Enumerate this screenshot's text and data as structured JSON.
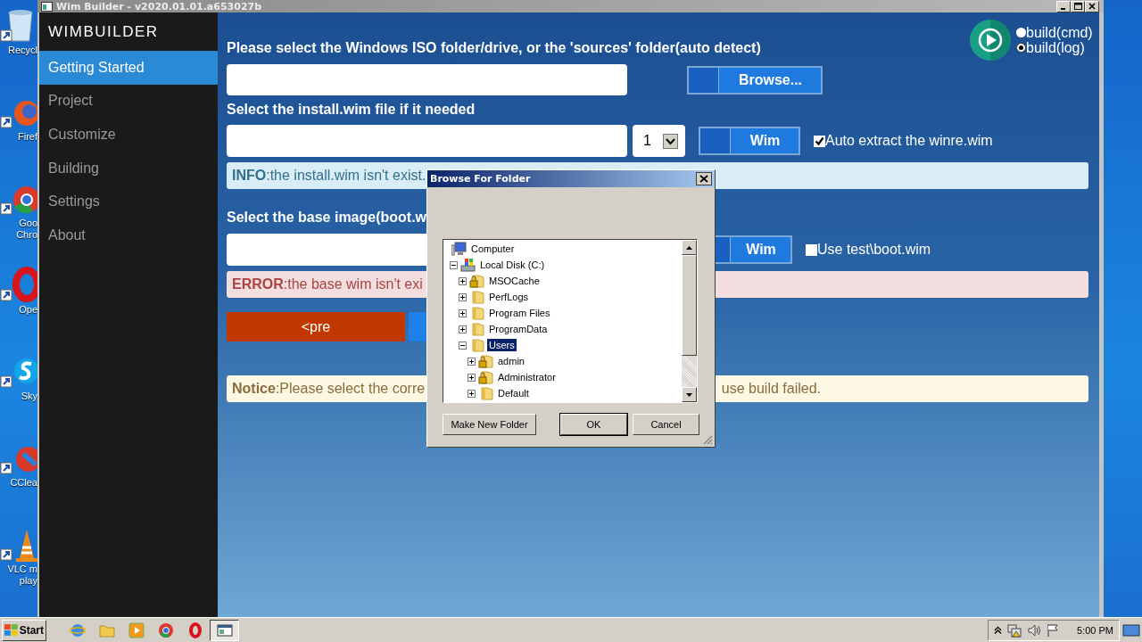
{
  "desktop_icons": [
    {
      "kind": "bin",
      "lines": [
        "Recycl"
      ]
    },
    {
      "kind": "fox",
      "lines": [
        "Firef"
      ]
    },
    {
      "kind": "chrome",
      "lines": [
        "Goo",
        "Chro"
      ]
    },
    {
      "kind": "opera",
      "lines": [
        "Ope"
      ]
    },
    {
      "kind": "skype",
      "lines": [
        "Sky"
      ]
    },
    {
      "kind": "brush",
      "lines": [
        "CClea"
      ]
    },
    {
      "kind": "cone",
      "lines": [
        "VLC m",
        "play"
      ]
    }
  ],
  "window": {
    "title": "Wim Builder - v2020.01.01.a653027b"
  },
  "sidebar": {
    "brand": "WIMBUILDER",
    "items": [
      {
        "label": "Getting Started",
        "selected": true
      },
      {
        "label": "Project",
        "selected": false
      },
      {
        "label": "Customize",
        "selected": false
      },
      {
        "label": "Building",
        "selected": false
      },
      {
        "label": "Settings",
        "selected": false
      },
      {
        "label": "About",
        "selected": false
      }
    ]
  },
  "build_modes": [
    {
      "label": "build(cmd)",
      "selected": false
    },
    {
      "label": "build(log)",
      "selected": true
    }
  ],
  "iso": {
    "heading": "Please select the Windows ISO folder/drive, or the 'sources' folder(auto detect)",
    "button": "Browse..."
  },
  "install_wim": {
    "heading": "Select the install.wim file if it needed",
    "index": "1",
    "button": "Wim",
    "option": {
      "label": "Auto extract the winre.wim",
      "checked": true
    },
    "message": {
      "kind": "info",
      "text": "**INFO**:the install.wim isn't exist."
    }
  },
  "base_image": {
    "heading": "Select the base image(boot.w",
    "button": "Wim",
    "option": {
      "label": "Use test\\boot.wim",
      "checked": false
    },
    "message": {
      "kind": "error",
      "text": "**ERROR**:the base wim isn't exi"
    }
  },
  "nav_buttons": [
    {
      "kind": "prev",
      "label": "<pre"
    },
    {
      "kind": "next"
    }
  ],
  "notice": {
    "kind": "notice",
    "text": "**Notice**:Please select the corre",
    "text_end": "use build failed."
  },
  "dialog": {
    "title": "Browse For Folder",
    "tree": [
      {
        "label": "Computer",
        "kind": "computer",
        "selected": false,
        "children": [
          {
            "label": "Local Disk (C:)",
            "kind": "drive",
            "expanded": true,
            "selected": false,
            "children": [
              {
                "label": "MSOCache",
                "kind": "folder",
                "expanded": false,
                "locked": true,
                "selected": false
              },
              {
                "label": "PerfLogs",
                "kind": "folder",
                "expanded": false,
                "selected": false
              },
              {
                "label": "Program Files",
                "kind": "folder",
                "expanded": false,
                "selected": false
              },
              {
                "label": "ProgramData",
                "kind": "folder",
                "expanded": false,
                "selected": false
              },
              {
                "label": "Users",
                "kind": "folder",
                "expanded": true,
                "selected": true,
                "children": [
                  {
                    "label": "admin",
                    "kind": "folder",
                    "expanded": false,
                    "locked": true,
                    "selected": false
                  },
                  {
                    "label": "Administrator",
                    "kind": "folder",
                    "expanded": false,
                    "locked": true,
                    "selected": false
                  },
                  {
                    "label": "Default",
                    "kind": "folder",
                    "expanded": false,
                    "selected": false
                  }
                ]
              }
            ]
          }
        ]
      }
    ],
    "buttons": [
      "Make New Folder",
      "OK",
      "Cancel"
    ]
  },
  "taskbar": {
    "start": "Start",
    "apps": [
      {
        "kind": "globe",
        "selected": false
      },
      {
        "kind": "folder",
        "selected": false
      },
      {
        "kind": "media",
        "selected": false
      },
      {
        "kind": "chrome",
        "selected": false
      },
      {
        "kind": "opera",
        "selected": false
      },
      {
        "kind": "window",
        "selected": true
      }
    ],
    "clock": "5:00 PM"
  }
}
